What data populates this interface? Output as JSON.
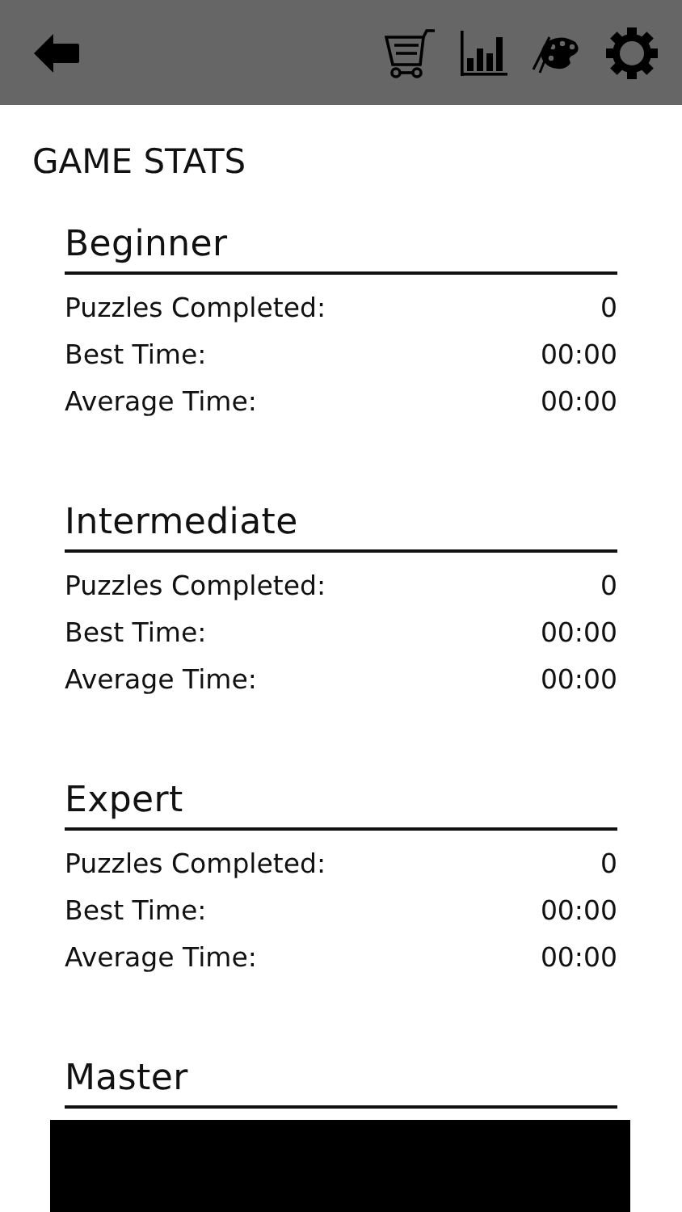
{
  "title": "GAME STATS",
  "sections": [
    {
      "heading": "Beginner",
      "rows": [
        {
          "label": "Puzzles Completed:",
          "value": "0"
        },
        {
          "label": "Best Time:",
          "value": "00:00"
        },
        {
          "label": "Average Time:",
          "value": "00:00"
        }
      ]
    },
    {
      "heading": "Intermediate",
      "rows": [
        {
          "label": "Puzzles Completed:",
          "value": "0"
        },
        {
          "label": "Best Time:",
          "value": "00:00"
        },
        {
          "label": "Average Time:",
          "value": "00:00"
        }
      ]
    },
    {
      "heading": "Expert",
      "rows": [
        {
          "label": "Puzzles Completed:",
          "value": "0"
        },
        {
          "label": "Best Time:",
          "value": "00:00"
        },
        {
          "label": "Average Time:",
          "value": "00:00"
        }
      ]
    },
    {
      "heading": "Master"
    }
  ]
}
